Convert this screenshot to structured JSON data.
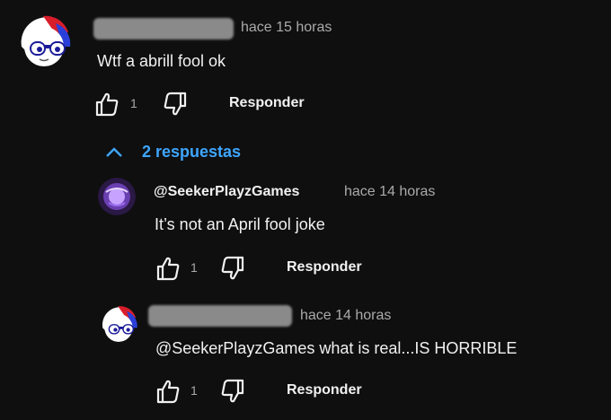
{
  "comment": {
    "time": "hace 15 horas",
    "text": "Wtf a abrill fool ok",
    "likes": "1",
    "reply_label": "Responder",
    "replies_toggle": "2 respuestas"
  },
  "replies": [
    {
      "author": "@SeekerPlayzGames",
      "time": "hace 14 horas",
      "text": "It’s not an April fool joke",
      "likes": "1",
      "reply_label": "Responder"
    },
    {
      "time": "hace 14 horas",
      "text": "@SeekerPlayzGames  what is real...IS HORRIBLE",
      "likes": "1",
      "reply_label": "Responder"
    }
  ],
  "icons": {
    "like": "thumbs-up-icon",
    "dislike": "thumbs-down-icon",
    "toggle": "chevron-up-icon"
  },
  "colors": {
    "background": "#0f0f0f",
    "link": "#3ea6ff",
    "meta": "#aaaaaa"
  }
}
